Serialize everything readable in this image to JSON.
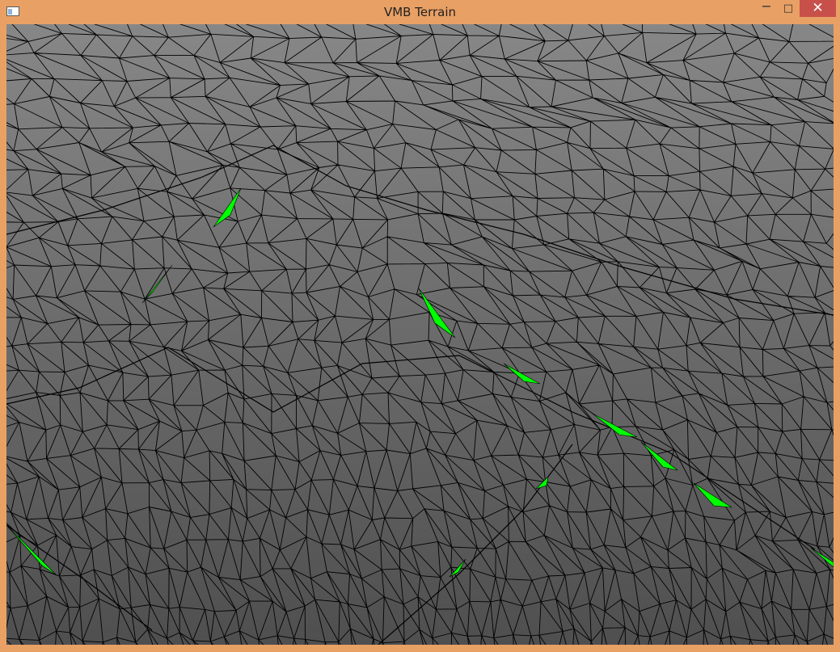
{
  "window": {
    "title": "VMB Terrain",
    "icon": "app-window-icon",
    "controls": {
      "minimize": "−",
      "maximize": "□",
      "close": "✕"
    }
  },
  "viewport": {
    "content": "3D wireframe terrain mesh",
    "colors": {
      "background_top": "#878787",
      "background_bottom": "#4f4f4f",
      "wire": "#000000",
      "highlight": "#00ff00",
      "frame": "#e9a064"
    }
  }
}
